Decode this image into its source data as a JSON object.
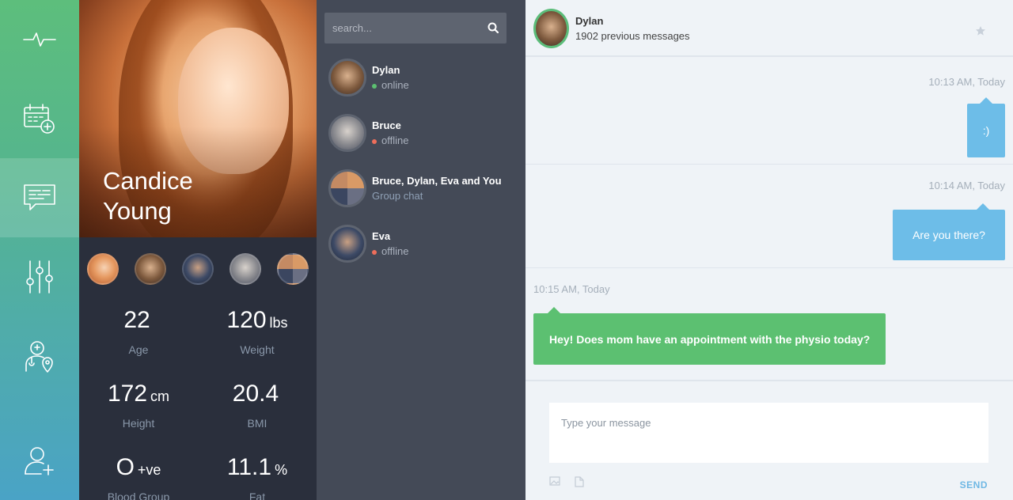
{
  "nav": {
    "items": [
      {
        "icon": "pulse-icon"
      },
      {
        "icon": "calendar-add-icon"
      },
      {
        "icon": "chat-icon",
        "active": true
      },
      {
        "icon": "sliders-icon"
      },
      {
        "icon": "doctor-location-icon"
      },
      {
        "icon": "add-user-icon"
      }
    ]
  },
  "profile": {
    "first_name": "Candice",
    "last_name": "Young",
    "stats": {
      "age": {
        "value": "22",
        "unit": "",
        "label": "Age"
      },
      "weight": {
        "value": "120",
        "unit": "lbs",
        "label": "Weight"
      },
      "height": {
        "value": "172",
        "unit": "cm",
        "label": "Height"
      },
      "bmi": {
        "value": "20.4",
        "unit": "",
        "label": "BMI"
      },
      "blood_group": {
        "value": "O",
        "unit": "+ve",
        "label": "Blood Group"
      },
      "fat": {
        "value": "11.1",
        "unit": "%",
        "label": "Fat"
      }
    }
  },
  "search": {
    "placeholder": "search..."
  },
  "contacts": [
    {
      "name": "Dylan",
      "status": "online",
      "status_color": "#5cc071"
    },
    {
      "name": "Bruce",
      "status": "offline",
      "status_color": "#ee6e5b"
    },
    {
      "name": "Bruce, Dylan, Eva and You",
      "status": "Group chat"
    },
    {
      "name": "Eva",
      "status": "offline",
      "status_color": "#ee6e5b"
    }
  ],
  "chat": {
    "header": {
      "name": "Dylan",
      "subtitle": "1902 previous messages"
    },
    "messages": [
      {
        "time": "10:13 AM, Today",
        "text": ":)",
        "side": "right"
      },
      {
        "time": "10:14 AM, Today",
        "text": "Are you there?",
        "side": "right"
      },
      {
        "time": "10:15 AM, Today",
        "text": "Hey! Does mom have an appointment with the physio today?",
        "side": "left"
      }
    ],
    "composer": {
      "placeholder": "Type your message",
      "send_label": "SEND"
    }
  },
  "colors": {
    "accent_green": "#5cc071",
    "accent_blue": "#6dbde8",
    "panel_dark": "#2a2f3c",
    "panel_mid": "#444a57"
  }
}
